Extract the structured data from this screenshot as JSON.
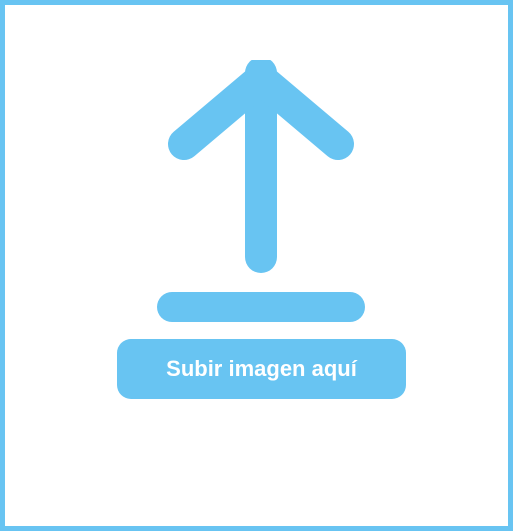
{
  "upload": {
    "icon": "upload-arrow-icon",
    "button_label": "Subir imagen aquí"
  },
  "colors": {
    "accent": "#68c4f2",
    "background": "#ffffff",
    "text_on_accent": "#ffffff"
  }
}
